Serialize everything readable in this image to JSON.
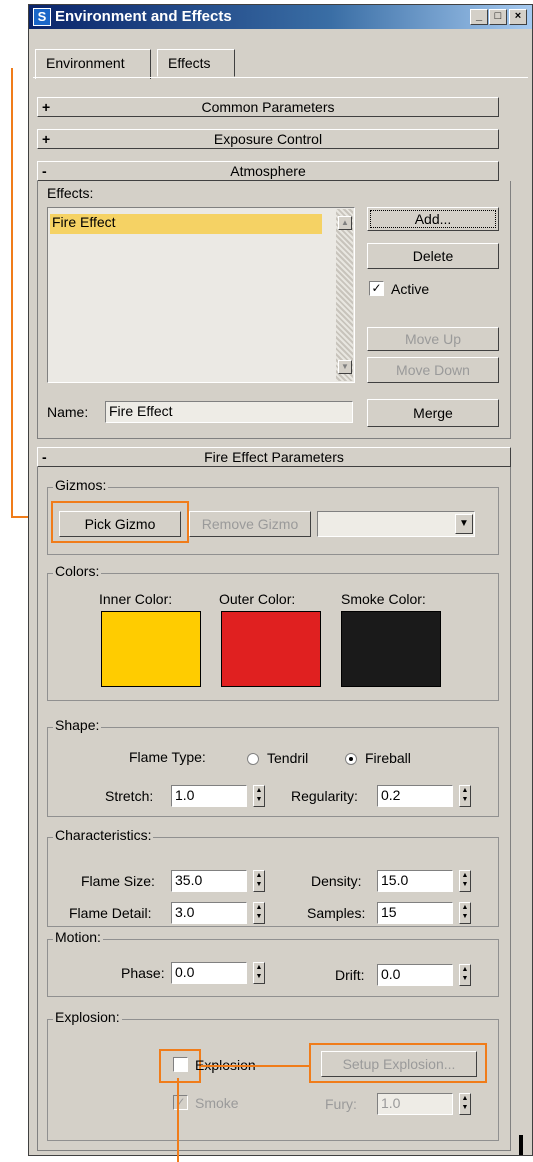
{
  "window": {
    "title": "Environment and Effects",
    "icon": "3ds-max-icon",
    "controls": [
      "_",
      "□",
      "×"
    ]
  },
  "tabs": [
    "Environment",
    "Effects"
  ],
  "rollouts": {
    "common": "Common Parameters",
    "exposure": "Exposure Control",
    "atmosphere": "Atmosphere",
    "fire": "Fire Effect Parameters",
    "plus": "+",
    "minus": "-"
  },
  "atmosphere": {
    "effects_label": "Effects:",
    "effects_list": [
      "Fire Effect"
    ],
    "add": "Add...",
    "delete": "Delete",
    "active_label": "Active",
    "active_checked": true,
    "move_up": "Move Up",
    "move_down": "Move Down",
    "name_label": "Name:",
    "name_value": "Fire Effect",
    "merge": "Merge"
  },
  "gizmos": {
    "label": "Gizmos:",
    "pick": "Pick Gizmo",
    "remove": "Remove Gizmo",
    "dropdown_value": ""
  },
  "colors": {
    "label": "Colors:",
    "inner_label": "Inner Color:",
    "outer_label": "Outer Color:",
    "smoke_label": "Smoke Color:",
    "inner": "#ffcc00",
    "outer": "#e02020",
    "smoke": "#1a1a1a"
  },
  "shape": {
    "label": "Shape:",
    "flame_type_label": "Flame Type:",
    "tendril": "Tendril",
    "fireball": "Fireball",
    "selected": "Fireball",
    "stretch_label": "Stretch:",
    "stretch": "1.0",
    "regularity_label": "Regularity:",
    "regularity": "0.2"
  },
  "characteristics": {
    "label": "Characteristics:",
    "flame_size_label": "Flame Size:",
    "flame_size": "35.0",
    "density_label": "Density:",
    "density": "15.0",
    "flame_detail_label": "Flame Detail:",
    "flame_detail": "3.0",
    "samples_label": "Samples:",
    "samples": "15"
  },
  "motion": {
    "label": "Motion:",
    "phase_label": "Phase:",
    "phase": "0.0",
    "drift_label": "Drift:",
    "drift": "0.0"
  },
  "explosion": {
    "label": "Explosion:",
    "explosion_label": "Explosion",
    "setup": "Setup Explosion...",
    "smoke_label": "Smoke",
    "fury_label": "Fury:",
    "fury": "1.0",
    "check_mark": "✓"
  },
  "colors_theme": {
    "highlight": "#f07c1a",
    "selection": "#f5d264"
  }
}
